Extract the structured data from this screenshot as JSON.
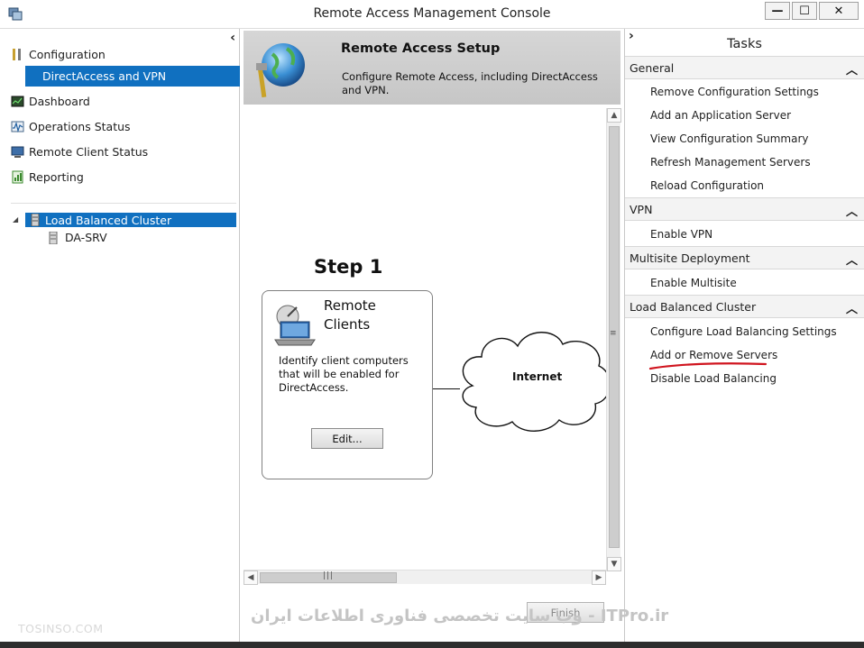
{
  "window": {
    "title": "Remote Access Management Console",
    "minimize": "—",
    "maximize": "☐",
    "close": "✕"
  },
  "nav": {
    "collapse": "‹",
    "configuration": "Configuration",
    "directaccess_vpn": "DirectAccess and VPN",
    "dashboard": "Dashboard",
    "operations_status": "Operations Status",
    "remote_client_status": "Remote Client Status",
    "reporting": "Reporting",
    "cluster": "Load Balanced Cluster",
    "cluster_toggle": "◢",
    "server": "DA-SRV"
  },
  "setup": {
    "title": "Remote Access Setup",
    "description": "Configure Remote Access, including DirectAccess and VPN.",
    "step_title": "Step 1",
    "card_title": "Remote Clients",
    "card_description": "Identify client computers that will be enabled for DirectAccess.",
    "edit_label": "Edit...",
    "cloud_label": "Internet",
    "finish_label": "Finish"
  },
  "tasks": {
    "expand": "›",
    "title": "Tasks",
    "sections": [
      {
        "header": "General",
        "items": [
          "Remove Configuration Settings",
          "Add an Application Server",
          "View Configuration Summary",
          "Refresh Management Servers",
          "Reload Configuration"
        ]
      },
      {
        "header": "VPN",
        "items": [
          "Enable VPN"
        ]
      },
      {
        "header": "Multisite Deployment",
        "items": [
          "Enable Multisite"
        ]
      },
      {
        "header": "Load Balanced Cluster",
        "items": [
          "Configure Load Balancing Settings",
          "Add or Remove Servers",
          "Disable Load Balancing"
        ]
      }
    ],
    "collapse_chevron": "︿",
    "annotation_color": "#d0141e"
  },
  "watermarks": {
    "left": "TOSINSO.COM",
    "right": "ITPro.ir - وب سایت تخصصی فناوری اطلاعات ایران"
  },
  "colors": {
    "selection": "#1070c0",
    "banner": "#cfcfcf"
  }
}
